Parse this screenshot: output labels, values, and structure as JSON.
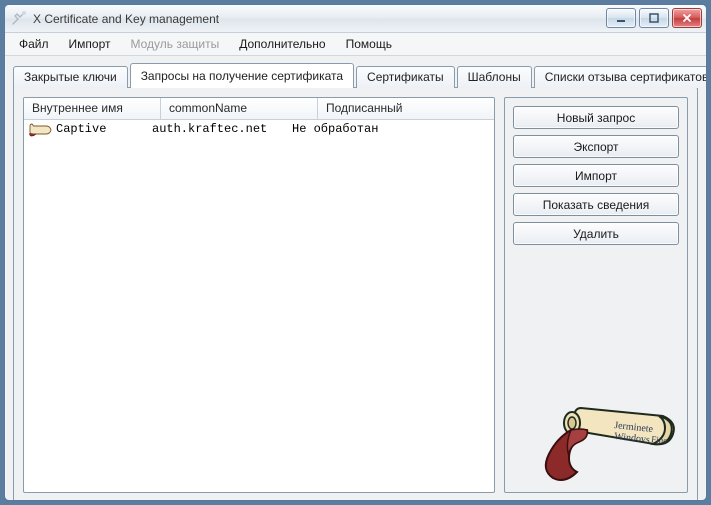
{
  "window": {
    "title": "X Certificate and Key management"
  },
  "menu": {
    "items": [
      "Файл",
      "Импорт",
      "Модуль защиты",
      "Дополнительно",
      "Помощь"
    ],
    "disabled_index": 2
  },
  "tabs": {
    "items": [
      "Закрытые ключи",
      "Запросы на получение сертификата",
      "Сертификаты",
      "Шаблоны",
      "Списки отзыва сертификатов"
    ],
    "active_index": 1
  },
  "list": {
    "columns": [
      "Внутреннее имя",
      "commonName",
      "Подписанный"
    ],
    "rows": [
      {
        "internal": "Captive",
        "cn": "auth.kraftec.net",
        "signed": "Не обработан"
      }
    ]
  },
  "actions": {
    "new_request": "Новый запрос",
    "export": "Экспорт",
    "import": "Импорт",
    "show_details": "Показать сведения",
    "delete": "Удалить"
  }
}
